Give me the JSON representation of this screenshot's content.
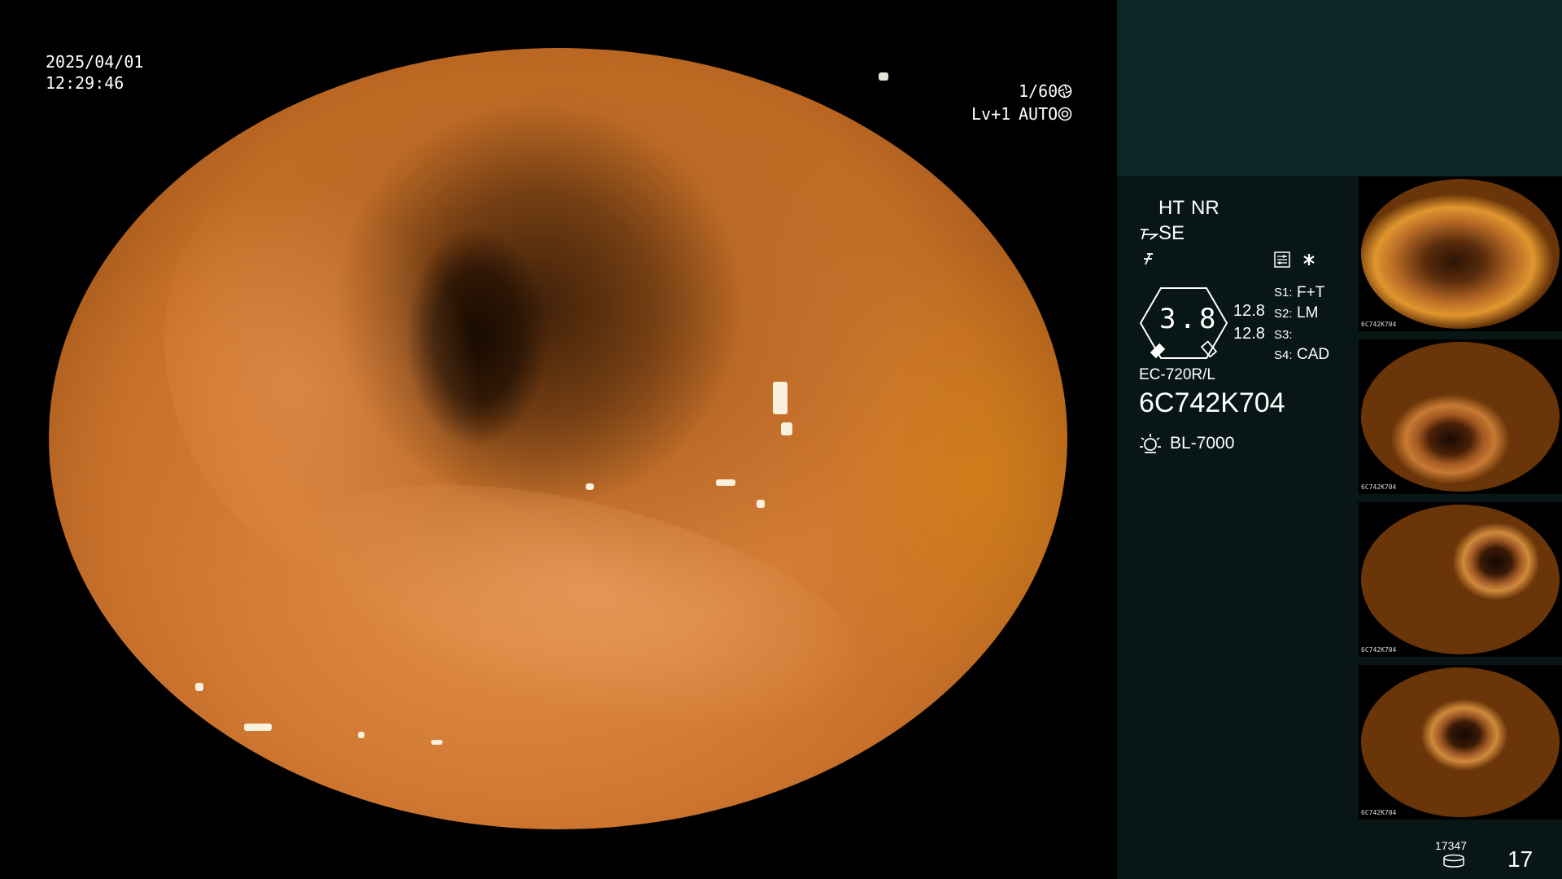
{
  "overlay": {
    "date": "2025/04/01",
    "time": "12:29:46",
    "shutter": "1/60",
    "level": "Lv+1",
    "iris_mode": "AUTO"
  },
  "panel": {
    "ht": "HT",
    "nr": "NR",
    "se": "SE",
    "zoom": "3.8",
    "values": [
      "12.8",
      "12.8"
    ],
    "switches": [
      {
        "key": "S1:",
        "value": "F+T"
      },
      {
        "key": "S2:",
        "value": "LM"
      },
      {
        "key": "S3:",
        "value": ""
      },
      {
        "key": "S4:",
        "value": "CAD"
      }
    ],
    "scope_model": "EC-720R/L",
    "scope_serial": "6C742K704",
    "light_source": "BL-7000",
    "image_count": "17347",
    "capture_index": "17"
  },
  "thumbnails": [
    {
      "id": "thumb-1",
      "label": "6C742K704"
    },
    {
      "id": "thumb-2",
      "label": "6C742K704"
    },
    {
      "id": "thumb-3",
      "label": "6C742K704"
    },
    {
      "id": "thumb-4",
      "label": "6C742K704"
    }
  ],
  "colors": {
    "accent": "#f4a43c",
    "panel_top": "#0b2626",
    "panel_bottom": "#081616"
  }
}
